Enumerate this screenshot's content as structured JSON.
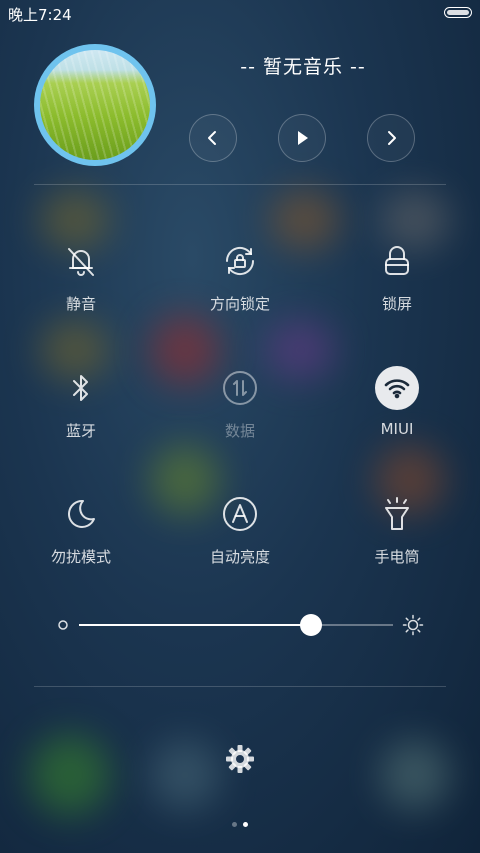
{
  "status_bar": {
    "time": "晚上7:24"
  },
  "music": {
    "title": "-- 暂无音乐 --",
    "prev_icon": "chevron-left-icon",
    "play_icon": "play-icon",
    "next_icon": "chevron-right-icon"
  },
  "toggles": [
    {
      "key": "mute",
      "label": "静音",
      "icon": "bell-off-icon",
      "state": "off"
    },
    {
      "key": "rotation",
      "label": "方向锁定",
      "icon": "rotation-lock-icon",
      "state": "off"
    },
    {
      "key": "lock",
      "label": "锁屏",
      "icon": "lock-icon",
      "state": "off"
    },
    {
      "key": "bluetooth",
      "label": "蓝牙",
      "icon": "bluetooth-icon",
      "state": "off"
    },
    {
      "key": "data",
      "label": "数据",
      "icon": "mobile-data-icon",
      "state": "disabled"
    },
    {
      "key": "wifi",
      "label": "MIUI",
      "icon": "wifi-icon",
      "state": "on"
    },
    {
      "key": "dnd",
      "label": "勿扰模式",
      "icon": "moon-icon",
      "state": "off"
    },
    {
      "key": "auto_brightness",
      "label": "自动亮度",
      "icon": "auto-brightness-icon",
      "state": "off"
    },
    {
      "key": "flashlight",
      "label": "手电筒",
      "icon": "flashlight-icon",
      "state": "off"
    }
  ],
  "brightness": {
    "level_fraction": 0.74,
    "low_icon": "brightness-low-icon",
    "high_icon": "brightness-high-icon"
  },
  "settings_icon": "gear-icon",
  "pager": {
    "page_count": 2,
    "current_page": 2
  },
  "colors": {
    "wifi_active_bg": "#e8eaed",
    "album_ring": "#6fc3ee"
  }
}
